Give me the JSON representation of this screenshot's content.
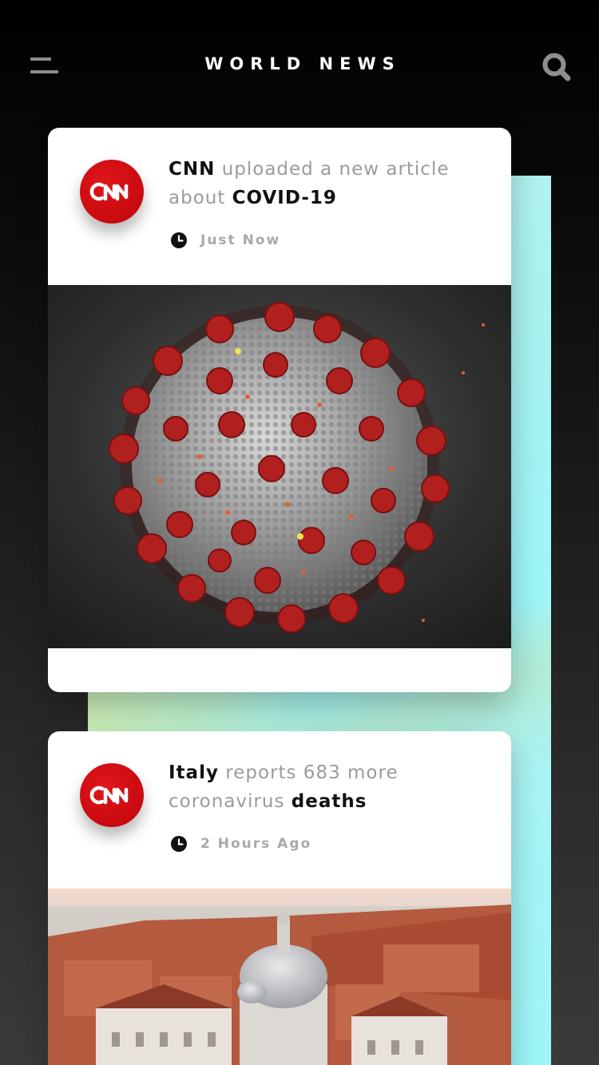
{
  "header": {
    "title": "WORLD NEWS",
    "menu_icon": "menu-icon",
    "search_icon": "search-icon"
  },
  "colors": {
    "background_top": "#000000",
    "background_bottom": "#3a3a3a",
    "accent_panel": "#a6f3f2",
    "brand_red": "#cc0000",
    "headline_strong": "#111111",
    "headline_muted": "#9b9b9b",
    "time_text": "#a9a9a9"
  },
  "feed": [
    {
      "source": "CNN",
      "headline_parts": [
        "CNN",
        " uploaded a new article about ",
        "COVID-19"
      ],
      "time": "Just Now",
      "image": "coronavirus-illustration"
    },
    {
      "source": "CNN",
      "headline_parts": [
        "Italy",
        " reports 683 more coronavirus ",
        "deaths"
      ],
      "time": "2 Hours Ago",
      "image": "venice-aerial-photo"
    }
  ]
}
